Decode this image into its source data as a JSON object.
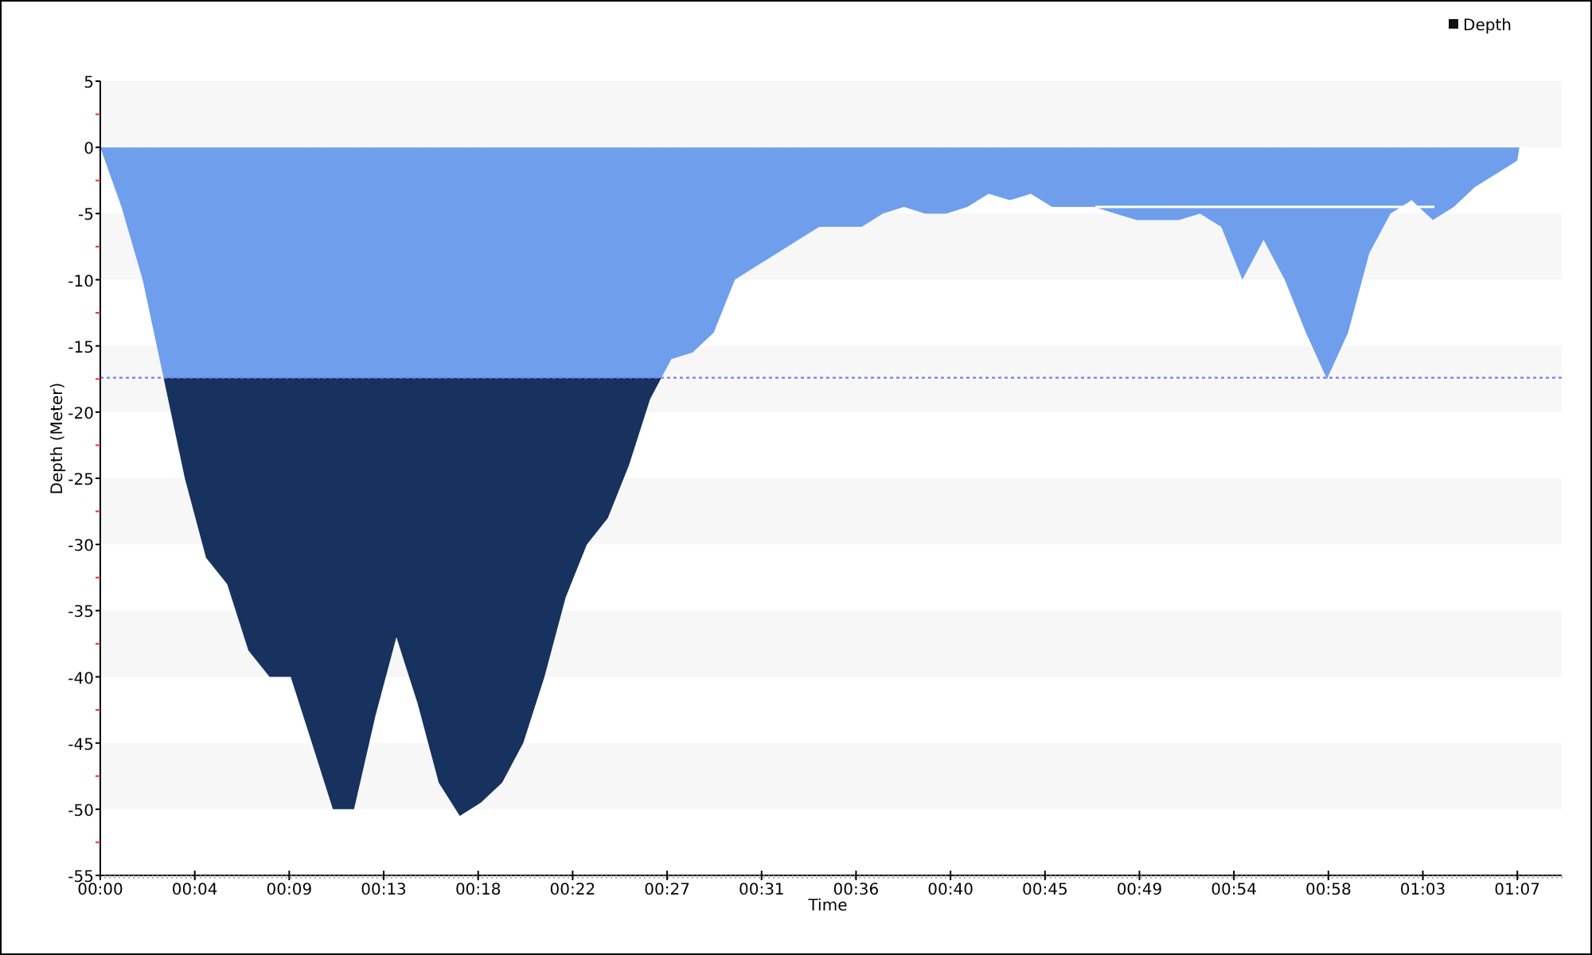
{
  "chart": {
    "chart_data": {
      "type": "area",
      "xlabel": "Time",
      "ylabel": "Depth (Meter)",
      "x": [
        0,
        1,
        2,
        3,
        4,
        5,
        6,
        7,
        8,
        9,
        10,
        11,
        12,
        13,
        14,
        15,
        16,
        17,
        18,
        19,
        20,
        21,
        22,
        23,
        24,
        25,
        26,
        27,
        28,
        29,
        30,
        31,
        32,
        33,
        34,
        35,
        36,
        37,
        38,
        39,
        40,
        41,
        42,
        43,
        44,
        45,
        46,
        47,
        48,
        49,
        50,
        51,
        52,
        53,
        54,
        55,
        56,
        57,
        58,
        59,
        60,
        61,
        62,
        63,
        64,
        65,
        66,
        67,
        67.1
      ],
      "series": [
        {
          "name": "Depth",
          "color": "#6f9fec",
          "values": [
            0,
            -4.5,
            -10,
            -17.5,
            -25,
            -31,
            -33,
            -38,
            -40,
            -40,
            -45,
            -50,
            -50,
            -43,
            -37,
            -42,
            -48,
            -50.5,
            -49.5,
            -48,
            -45,
            -40,
            -34,
            -30,
            -28,
            -24,
            -19,
            -16,
            -15.5,
            -14,
            -10,
            -9,
            -8,
            -7,
            -6,
            -6,
            -6,
            -5,
            -4.5,
            -5,
            -5,
            -4.5,
            -3.5,
            -4,
            -3.5,
            -4.5,
            -4.5,
            -4.5,
            -5,
            -5.5,
            -5.5,
            -5.5,
            -5,
            -6,
            -10,
            -7,
            -10,
            -14,
            -17.5,
            -14,
            -8,
            -5,
            -4,
            -5.5,
            -4.5,
            -3,
            -2,
            -1,
            0
          ]
        }
      ],
      "xlim": [
        0,
        69.1
      ],
      "ylim": [
        -55,
        5
      ],
      "xticks": [
        {
          "value": 0,
          "label": "00:00"
        },
        {
          "value": 4.467,
          "label": "00:04"
        },
        {
          "value": 8.933,
          "label": "00:09"
        },
        {
          "value": 13.4,
          "label": "00:13"
        },
        {
          "value": 17.867,
          "label": "00:18"
        },
        {
          "value": 22.333,
          "label": "00:22"
        },
        {
          "value": 26.8,
          "label": "00:27"
        },
        {
          "value": 31.267,
          "label": "00:31"
        },
        {
          "value": 35.733,
          "label": "00:36"
        },
        {
          "value": 40.2,
          "label": "00:40"
        },
        {
          "value": 44.667,
          "label": "00:45"
        },
        {
          "value": 49.133,
          "label": "00:49"
        },
        {
          "value": 53.6,
          "label": "00:54"
        },
        {
          "value": 58.067,
          "label": "00:58"
        },
        {
          "value": 62.533,
          "label": "01:03"
        },
        {
          "value": 67,
          "label": "01:07"
        }
      ],
      "yticks": [
        5,
        0,
        -5,
        -10,
        -15,
        -20,
        -25,
        -30,
        -35,
        -40,
        -45,
        -50,
        -55
      ],
      "ref_lines": [
        {
          "axis": "y",
          "value": -17.4
        },
        {
          "axis": "y",
          "value": -4.5
        }
      ]
    }
  }
}
